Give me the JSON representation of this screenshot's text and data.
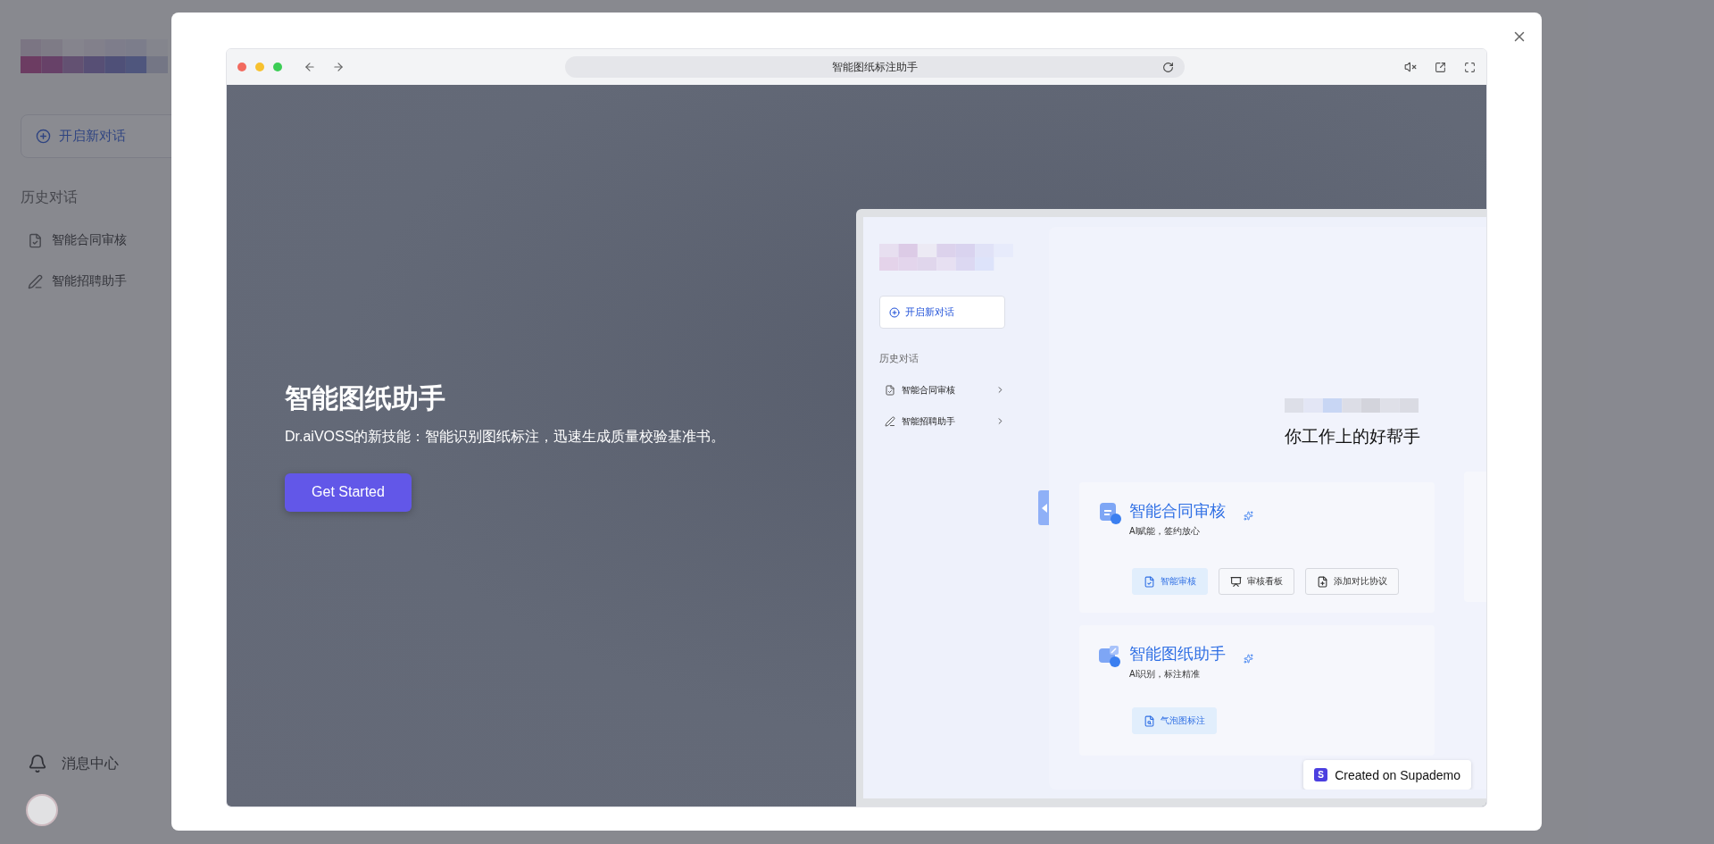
{
  "app_sidebar": {
    "new_chat_button": "开启新对话",
    "history_heading": "历史对话",
    "history_items": [
      {
        "label": "智能合同审核",
        "kind": "document"
      },
      {
        "label": "智能招聘助手",
        "kind": "pencil"
      }
    ],
    "notifications": "消息中心"
  },
  "demo_modal": {
    "browser": {
      "address": "智能图纸标注助手"
    },
    "hero": {
      "title": "智能图纸助手",
      "subtitle": "Dr.aiVOSS的新技能：智能识别图纸标注，迅速生成质量校验基准书。",
      "button": "Get Started"
    },
    "preview": {
      "new_chat_button": "开启新对话",
      "history_heading": "历史对话",
      "history_items": [
        {
          "label": "智能合同审核",
          "kind": "document"
        },
        {
          "label": "智能招聘助手",
          "kind": "pencil"
        }
      ],
      "tagline": "你工作上的好帮手",
      "cards": [
        {
          "title": "智能合同审核",
          "subtitle": "AI赋能，签约放心",
          "kind": "contract",
          "actions": [
            {
              "label": "智能审核",
              "kind": "review"
            },
            {
              "label": "审核看板",
              "kind": "board"
            },
            {
              "label": "添加对比协议",
              "kind": "compare"
            }
          ]
        },
        {
          "title": "智能图纸助手",
          "subtitle": "AI识别，标注精准",
          "kind": "drawing",
          "actions": [
            {
              "label": "气泡图标注",
              "kind": "bubble"
            }
          ]
        }
      ]
    },
    "badge": {
      "logo": "S",
      "text": "Created on Supademo"
    }
  }
}
